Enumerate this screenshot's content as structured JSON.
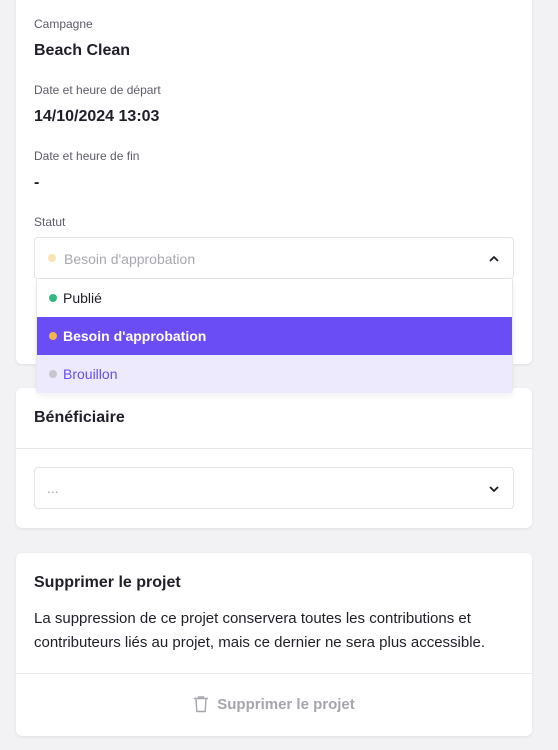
{
  "campaign": {
    "label": "Campagne",
    "value": "Beach Clean"
  },
  "start": {
    "label": "Date et heure de départ",
    "value": "14/10/2024 13:03"
  },
  "end": {
    "label": "Date et heure de fin",
    "value": "-"
  },
  "status": {
    "label": "Statut",
    "selected": "Besoin d'approbation",
    "selected_dot_color": "#f7e3b3",
    "options": [
      {
        "label": "Publié",
        "dot_color": "#35b880",
        "text_color": "#1f1f29",
        "state": "normal"
      },
      {
        "label": "Besoin d'approbation",
        "dot_color": "#f5b54d",
        "text_color": "#ffffff",
        "state": "selected"
      },
      {
        "label": "Brouillon",
        "dot_color": "#c6c6cc",
        "text_color": "#6a4df4",
        "state": "hover"
      }
    ]
  },
  "beneficiary": {
    "title": "Bénéficiaire",
    "placeholder": "..."
  },
  "delete_project": {
    "title": "Supprimer le projet",
    "description": "La suppression de ce projet conservera toutes les contributions et contributeurs liés au projet, mais ce dernier ne sera plus accessible.",
    "button_label": "Supprimer le projet",
    "button_icon": "trash-icon"
  },
  "colors": {
    "accent": "#6a4df4",
    "accent_light": "#eeeafd"
  }
}
